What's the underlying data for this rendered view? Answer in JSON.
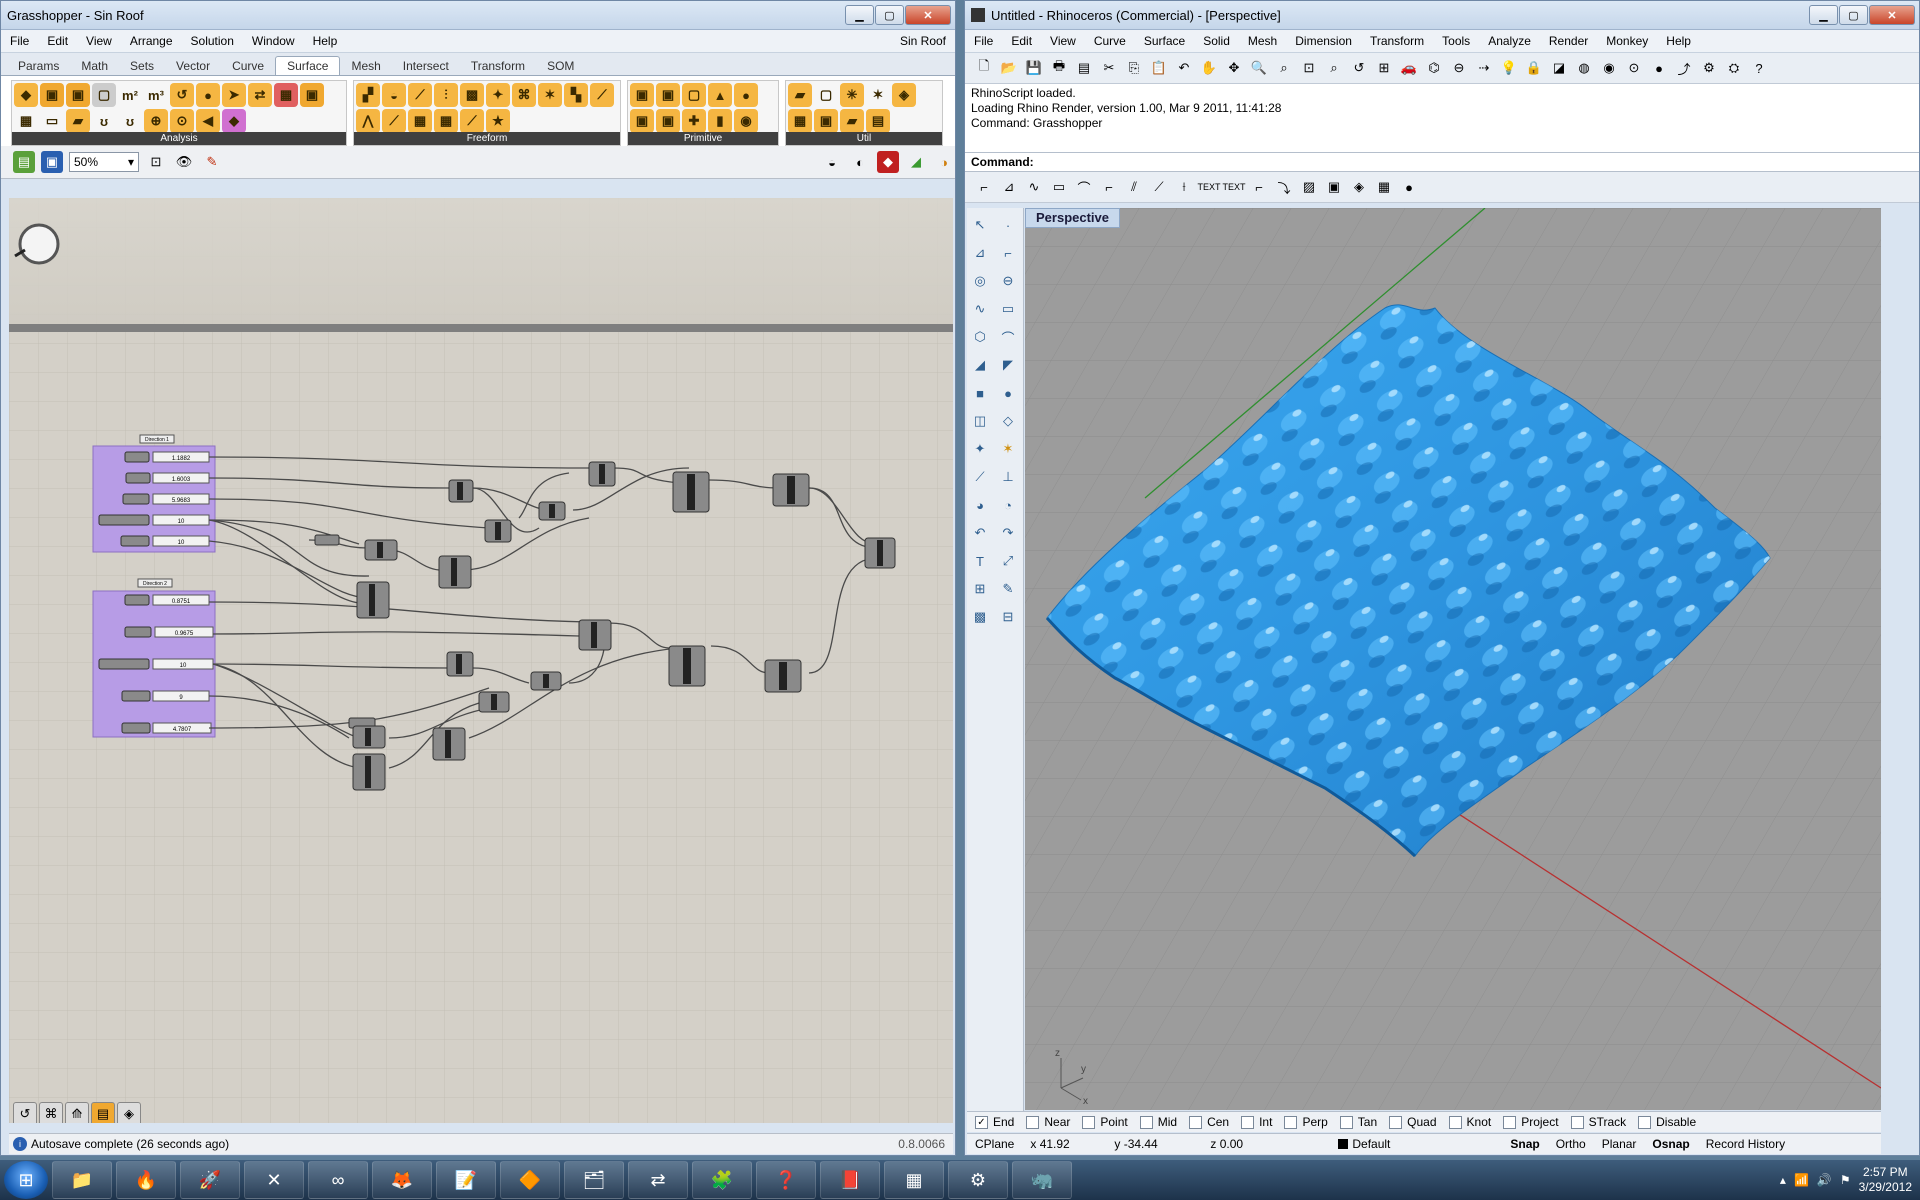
{
  "grasshopper": {
    "title": "Grasshopper - Sin Roof",
    "menu": [
      "File",
      "Edit",
      "View",
      "Arrange",
      "Solution",
      "Window",
      "Help"
    ],
    "doc_name": "Sin Roof",
    "tabs": [
      "Params",
      "Math",
      "Sets",
      "Vector",
      "Curve",
      "Surface",
      "Mesh",
      "Intersect",
      "Transform",
      "SOM"
    ],
    "active_tab": "Surface",
    "groups": [
      {
        "label": "Analysis",
        "icons": [
          "Rhino",
          "m²",
          "m³",
          "Area"
        ]
      },
      {
        "label": "Freeform",
        "icons": [
          "Loft",
          "Sweep"
        ]
      },
      {
        "label": "Primitive",
        "icons": [
          "Box",
          "Sphere"
        ]
      },
      {
        "label": "Util",
        "icons": [
          "Divide",
          "Tag"
        ]
      }
    ],
    "zoom": "50%",
    "sliders_group1": [
      "1.1882",
      "1.6003",
      "5.9683",
      "10",
      "10"
    ],
    "sliders_group2": [
      "0.8751",
      "0.9675",
      "10",
      "9",
      "4.7807"
    ],
    "group1_title": "Direction 1",
    "group2_title": "Direction 2",
    "status": "Autosave complete (26 seconds ago)",
    "version": "0.8.0066"
  },
  "rhino": {
    "title": "Untitled - Rhinoceros (Commercial) - [Perspective]",
    "menu": [
      "File",
      "Edit",
      "View",
      "Curve",
      "Surface",
      "Solid",
      "Mesh",
      "Dimension",
      "Transform",
      "Tools",
      "Analyze",
      "Render",
      "Monkey",
      "Help"
    ],
    "history": [
      "RhinoScript loaded.",
      "Loading Rhino Render, version 1.00, Mar  9 2011, 11:41:28",
      "Command: Grasshopper"
    ],
    "command_label": "Command:",
    "viewport_label": "Perspective",
    "osnaps": [
      {
        "label": "End",
        "checked": true
      },
      {
        "label": "Near",
        "checked": false
      },
      {
        "label": "Point",
        "checked": false
      },
      {
        "label": "Mid",
        "checked": false
      },
      {
        "label": "Cen",
        "checked": false
      },
      {
        "label": "Int",
        "checked": false
      },
      {
        "label": "Perp",
        "checked": false
      },
      {
        "label": "Tan",
        "checked": false
      },
      {
        "label": "Quad",
        "checked": false
      },
      {
        "label": "Knot",
        "checked": false
      },
      {
        "label": "Project",
        "checked": false
      },
      {
        "label": "STrack",
        "checked": false
      },
      {
        "label": "Disable",
        "checked": false
      }
    ],
    "status": {
      "cplane": "CPlane",
      "x": "x 41.92",
      "y": "y -34.44",
      "z": "z 0.00",
      "layer": "Default",
      "snap": "Snap",
      "ortho": "Ortho",
      "planar": "Planar",
      "osnap": "Osnap",
      "record": "Record History"
    },
    "axis_labels": {
      "x": "x",
      "y": "y",
      "z": "z"
    }
  },
  "taskbar": {
    "time": "2:57 PM",
    "date": "3/29/2012"
  },
  "colors": {
    "surface": "#2e9be6",
    "group": "#b79ce6",
    "canvas": "#d4d0c8"
  }
}
